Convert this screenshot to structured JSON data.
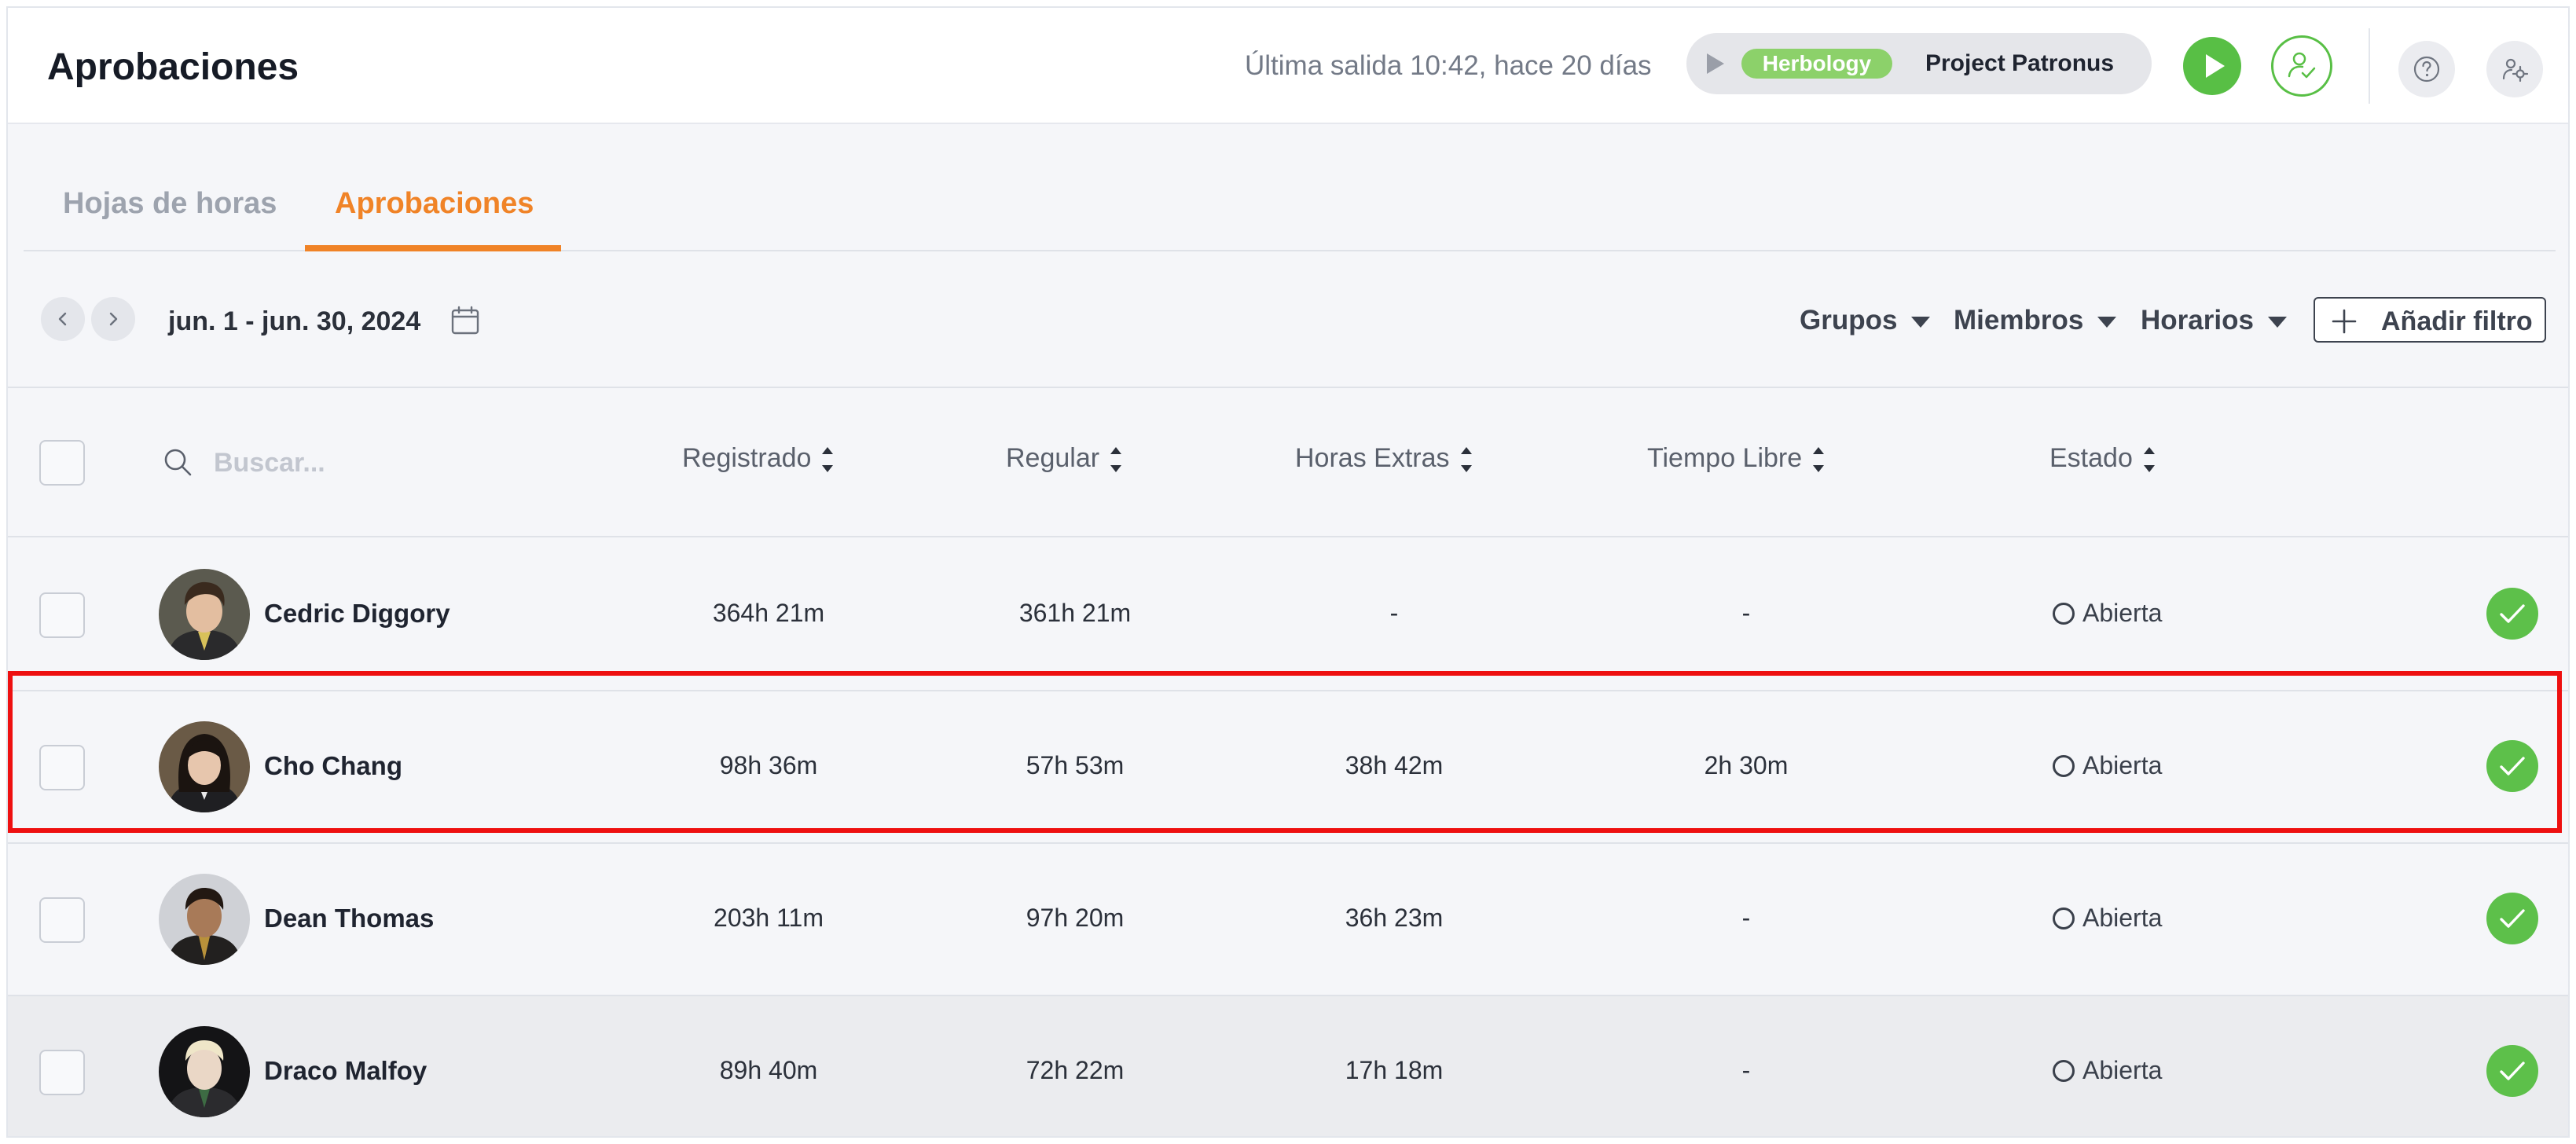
{
  "header": {
    "title": "Aprobaciones",
    "last_exit": "Última salida 10:42, hace 20 días",
    "timer": {
      "tag": "Herbology",
      "project": "Project Patronus"
    },
    "icons": [
      "play-icon",
      "approve-user-icon",
      "help-icon",
      "settings-icon"
    ]
  },
  "tabs": [
    {
      "label": "Hojas de horas",
      "active": false
    },
    {
      "label": "Aprobaciones",
      "active": true
    }
  ],
  "toolbar": {
    "date_range": "jun. 1 - jun. 30, 2024",
    "filters": {
      "groups": "Grupos",
      "members": "Miembros",
      "schedules": "Horarios"
    },
    "add_filter": "Añadir filtro"
  },
  "search": {
    "placeholder": "Buscar..."
  },
  "columns": {
    "registered": "Registrado",
    "regular": "Regular",
    "overtime": "Horas Extras",
    "timeoff": "Tiempo Libre",
    "status": "Estado"
  },
  "rows": [
    {
      "name": "Cedric Diggory",
      "registered": "364h 21m",
      "regular": "361h 21m",
      "overtime": "-",
      "timeoff": "-",
      "status": "Abierta"
    },
    {
      "name": "Cho Chang",
      "registered": "98h 36m",
      "regular": "57h 53m",
      "overtime": "38h 42m",
      "timeoff": "2h 30m",
      "status": "Abierta"
    },
    {
      "name": "Dean Thomas",
      "registered": "203h 11m",
      "regular": "97h 20m",
      "overtime": "36h 23m",
      "timeoff": "-",
      "status": "Abierta"
    },
    {
      "name": "Draco Malfoy",
      "registered": "89h 40m",
      "regular": "72h 22m",
      "overtime": "17h 18m",
      "timeoff": "-",
      "status": "Abierta"
    }
  ],
  "colors": {
    "accent": "#f08327",
    "success": "#58bf45",
    "tag": "#8cd16a",
    "highlight": "#ee1010"
  }
}
